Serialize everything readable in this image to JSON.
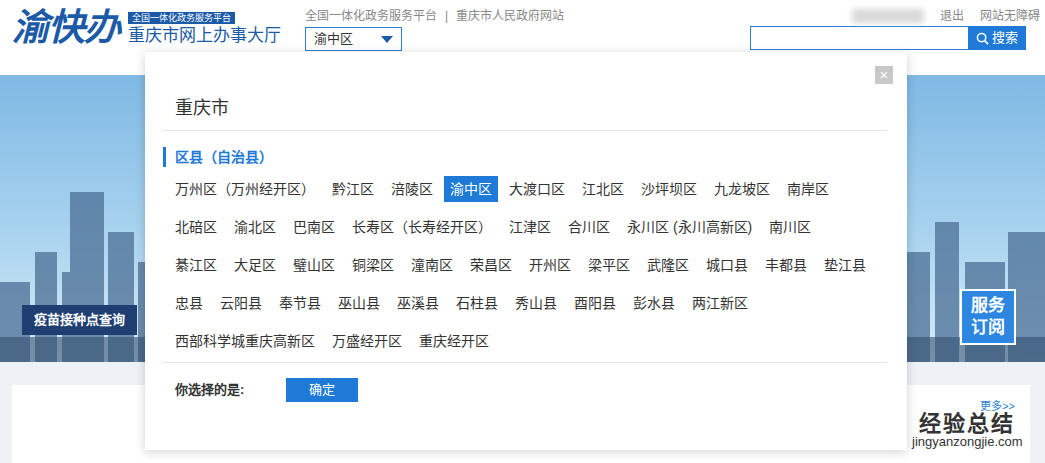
{
  "header": {
    "logo": "渝快办",
    "badge": "全国一体化政务服务平台",
    "site_title": "重庆市网上办事大厅",
    "links": [
      "全国一体化政务服务平台",
      "重庆市人民政府网站"
    ],
    "separator": "|",
    "region_select": "渝中区",
    "logout": "退出",
    "accessibility": "网站无障碍",
    "search_button": "搜索"
  },
  "banner": {
    "side_tab": "疫苗接种点查询",
    "subscribe": "服务订阅"
  },
  "content": {
    "more": "更多>>"
  },
  "region_dialog": {
    "close": "×",
    "city": "重庆市",
    "section": "区县（自治县）",
    "rows": [
      [
        {
          "label": "万州区（万州经开区）",
          "selected": false
        },
        {
          "label": "黔江区",
          "selected": false
        },
        {
          "label": "涪陵区",
          "selected": false
        },
        {
          "label": "渝中区",
          "selected": true
        },
        {
          "label": "大渡口区",
          "selected": false
        },
        {
          "label": "江北区",
          "selected": false
        },
        {
          "label": "沙坪坝区",
          "selected": false
        },
        {
          "label": "九龙坡区",
          "selected": false
        },
        {
          "label": "南岸区",
          "selected": false
        }
      ],
      [
        {
          "label": "北碚区",
          "selected": false
        },
        {
          "label": "渝北区",
          "selected": false
        },
        {
          "label": "巴南区",
          "selected": false
        },
        {
          "label": "长寿区（长寿经开区）",
          "selected": false
        },
        {
          "label": "江津区",
          "selected": false
        },
        {
          "label": "合川区",
          "selected": false
        },
        {
          "label": "永川区 (永川高新区)",
          "selected": false
        },
        {
          "label": "南川区",
          "selected": false
        }
      ],
      [
        {
          "label": "綦江区",
          "selected": false
        },
        {
          "label": "大足区",
          "selected": false
        },
        {
          "label": "璧山区",
          "selected": false
        },
        {
          "label": "铜梁区",
          "selected": false
        },
        {
          "label": "潼南区",
          "selected": false
        },
        {
          "label": "荣昌区",
          "selected": false
        },
        {
          "label": "开州区",
          "selected": false
        },
        {
          "label": "梁平区",
          "selected": false
        },
        {
          "label": "武隆区",
          "selected": false
        },
        {
          "label": "城口县",
          "selected": false
        },
        {
          "label": "丰都县",
          "selected": false
        },
        {
          "label": "垫江县",
          "selected": false
        }
      ],
      [
        {
          "label": "忠县",
          "selected": false
        },
        {
          "label": "云阳县",
          "selected": false
        },
        {
          "label": "奉节县",
          "selected": false
        },
        {
          "label": "巫山县",
          "selected": false
        },
        {
          "label": "巫溪县",
          "selected": false
        },
        {
          "label": "石柱县",
          "selected": false
        },
        {
          "label": "秀山县",
          "selected": false
        },
        {
          "label": "酉阳县",
          "selected": false
        },
        {
          "label": "彭水县",
          "selected": false
        },
        {
          "label": "两江新区",
          "selected": false
        }
      ],
      [
        {
          "label": "西部科学城重庆高新区",
          "selected": false
        },
        {
          "label": "万盛经开区",
          "selected": false
        },
        {
          "label": "重庆经开区",
          "selected": false
        }
      ]
    ],
    "chosen_label": "你选择的是:",
    "confirm": "确定"
  },
  "watermark": {
    "title": "经验总结",
    "url": "jingyanzongjie.com"
  }
}
